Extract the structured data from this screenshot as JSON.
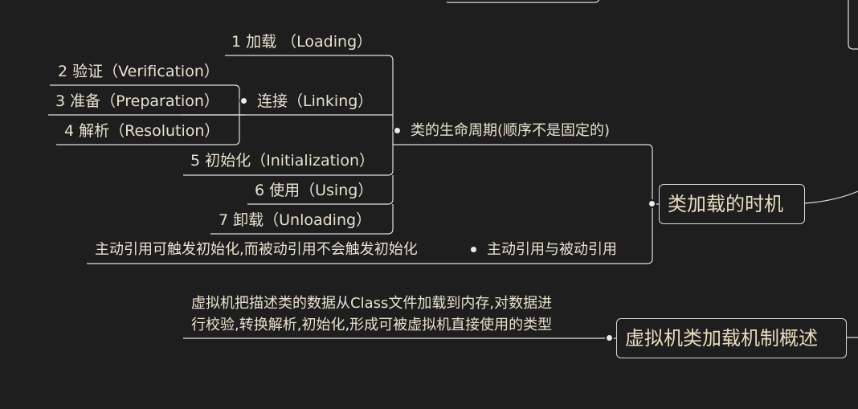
{
  "nodes": {
    "timing_box": "类加载的时机",
    "overview_box": "虚拟机类加载机制概述",
    "lifecycle": "类的生命周期(顺序不是固定的)",
    "active_passive": "主动引用与被动引用",
    "active_passive_detail": "主动引用可触发初始化,而被动引用不会触发初始化",
    "overview_detail_line1": "虚拟机把描述类的数据从Class文件加载到内存,对数据进",
    "overview_detail_line2": "行校验,转换解析,初始化,形成可被虚拟机直接使用的类型",
    "stage1": "1 加载 （Loading）",
    "linking": "连接（Linking）",
    "stage2": "2 验证（Verification）",
    "stage3": "3 准备（Preparation）",
    "stage4": "4 解析（Resolution）",
    "stage5": "5 初始化（Initialization）",
    "stage6": "6 使用（Using）",
    "stage7": "7 卸载（Unloading）"
  }
}
